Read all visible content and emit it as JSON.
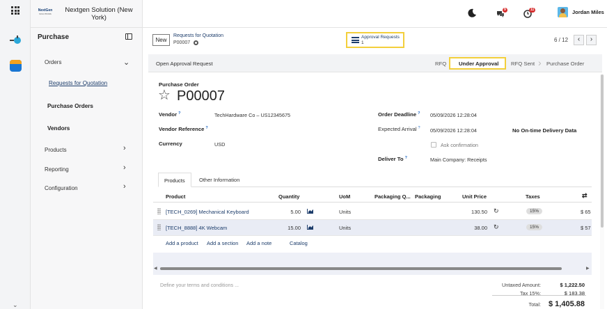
{
  "company": {
    "logo_text": "NextGen",
    "logo_sub": "SOLUTIONS",
    "name": "Nextgen Solution (New York)"
  },
  "sidebar": {
    "app_title": "Purchase",
    "orders_label": "Orders",
    "items": [
      {
        "label": "Requests for Quotation"
      },
      {
        "label": "Purchase Orders"
      },
      {
        "label": "Vendors"
      }
    ],
    "products_label": "Products",
    "reporting_label": "Reporting",
    "configuration_label": "Configuration"
  },
  "topbar": {
    "chat_badge": "9",
    "activity_badge": "11",
    "user_name": "Jordan Miles"
  },
  "control": {
    "new_label": "New",
    "breadcrumb_parent": "Requests for Quotation",
    "breadcrumb_current": "P00007",
    "smart_button_label": "Approval Requests",
    "smart_button_count": "1",
    "pager": "6 / 12"
  },
  "status": {
    "open_approval": "Open Approval Request",
    "steps": [
      "RFQ",
      "Under Approval",
      "RFQ Sent",
      "Purchase Order"
    ]
  },
  "form": {
    "title_label": "Purchase Order",
    "name": "P00007",
    "vendor_label": "Vendor",
    "vendor_value": "TechHardware Co – US12345675",
    "vendor_ref_label": "Vendor Reference",
    "currency_label": "Currency",
    "currency_value": "USD",
    "order_deadline_label": "Order Deadline",
    "order_deadline_value": "05/09/2026 12:28:04",
    "expected_arrival_label": "Expected Arrival",
    "expected_arrival_value": "05/09/2026 12:28:04",
    "no_delivery_data": "No On-time Delivery Data",
    "ask_confirmation": "Ask confirmation",
    "deliver_to_label": "Deliver To",
    "deliver_to_value": "Main Company: Receipts"
  },
  "tabs": [
    "Products",
    "Other Information"
  ],
  "table": {
    "headers": {
      "product": "Product",
      "quantity": "Quantity",
      "uom": "UoM",
      "packaging_qty": "Packaging Q...",
      "packaging": "Packaging",
      "unit_price": "Unit Price",
      "taxes": "Taxes"
    },
    "rows": [
      {
        "product": "[TECH_0269] Mechanical Keyboard",
        "quantity": "5.00",
        "uom": "Units",
        "unit_price": "130.50",
        "tax": "15%",
        "subtotal": "$ 65"
      },
      {
        "product": "[TECH_8888] 4K Webcam",
        "quantity": "15.00",
        "uom": "Units",
        "unit_price": "38.00",
        "tax": "15%",
        "subtotal": "$ 57"
      }
    ],
    "add_product": "Add a product",
    "add_section": "Add a section",
    "add_note": "Add a note",
    "catalog": "Catalog"
  },
  "footer": {
    "terms_placeholder": "Define your terms and conditions ...",
    "untaxed_label": "Untaxed Amount:",
    "untaxed_value": "$ 1,222.50",
    "tax_label": "Tax 15%:",
    "tax_value": "$ 183.38",
    "total_label": "Total:",
    "total_value": "$ 1,405.88"
  }
}
